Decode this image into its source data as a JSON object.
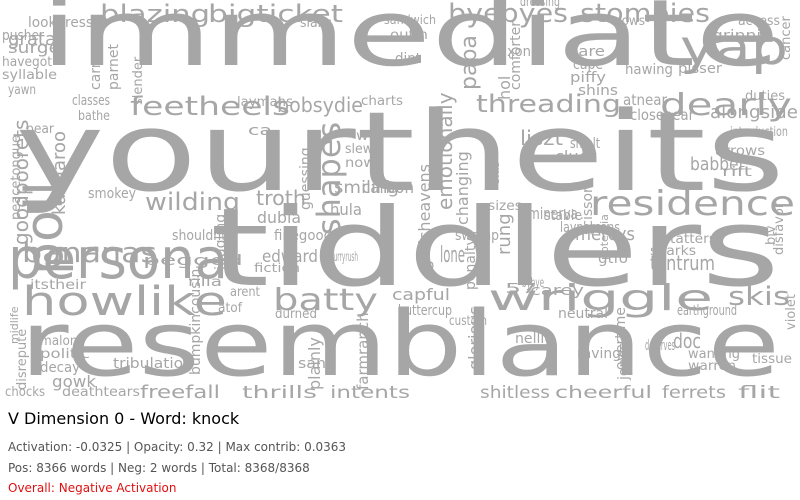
{
  "title": "V Dimension 0 - Word: knock",
  "stats_line": "Activation: -0.0325 | Opacity: 0.32 | Max contrib: 0.0363",
  "counts_line": "Pos: 8366 words | Neg: 2 words | Total: 8368/8368",
  "overall": "Overall: Negative Activation",
  "colors": {
    "word": "#a6a6a6",
    "title": "#000000",
    "meta": "#555555",
    "overall": "#e01010"
  },
  "word_cloud": [
    "immediate",
    "yourtheits",
    "tiddlers",
    "resemblance",
    "persona",
    "howlike",
    "poll",
    "bananas",
    "feetheels",
    "residence",
    "wriggle",
    "yap",
    "dearly",
    "byebyes",
    "stompies",
    "blazing",
    "bigticket",
    "threading",
    "batty",
    "bobsydie",
    "shapes",
    "skis",
    "wilding",
    "tantrum",
    "alongside",
    "mercys",
    "babber",
    "goodpoorets",
    "kangaroo",
    "grata",
    "lookdress",
    "pusher",
    "havegot",
    "syllable",
    "yawn",
    "surge",
    "classes",
    "bathe",
    "pear",
    "smokey",
    "peacetongue",
    "smiling",
    "hula",
    "carbon",
    "emotionally",
    "changing",
    "liszt",
    "cluck",
    "minerva",
    "smelt",
    "atnear",
    "closenear",
    "duties",
    "arrows",
    "flit",
    "ferrets",
    "cheerful",
    "shitless",
    "intents",
    "thrills",
    "freefall",
    "gowk",
    "decay",
    "politic",
    "malone",
    "disrepute",
    "midlife",
    "chocks",
    "deathtears",
    "tribulation",
    "nellie",
    "glorious",
    "jones",
    "raving",
    "wanting",
    "warren",
    "tissue",
    "capful",
    "buttercup",
    "custom",
    "neutral",
    "carey",
    "earthground",
    "troth",
    "dubia",
    "edward",
    "fiction",
    "finegood",
    "shouldnt",
    "itstheir",
    "rilla",
    "atof",
    "arent",
    "durned",
    "plainly",
    "farmranch",
    "scissors",
    "sharks",
    "tatters",
    "sizes",
    "rung",
    "stable",
    "laypersons",
    "penalty",
    "potentia",
    "gtfo",
    "swamp",
    "godsheavens",
    "juggling",
    "guessing",
    "slew",
    "nowt",
    "wily",
    "charts",
    "laymans",
    "nixon",
    "isare",
    "cape",
    "piffy",
    "shins",
    "hawing",
    "pisser",
    "grinnin",
    "access",
    "cows",
    "papa",
    "dint",
    "outin",
    "sandwich",
    "slans",
    "slender",
    "carney",
    "parnet",
    "dressing",
    "cancer",
    "pegged",
    "bumpkincousin",
    "hurryrush",
    "lone",
    "57",
    "bybye",
    "san",
    "doc",
    "ca",
    "skis",
    "hol",
    "comforter",
    "overtime",
    "deserves",
    "violet",
    "disfavor",
    "biv",
    "rift",
    "introduction",
    "ablebodied",
    "shag",
    "dite",
    "reading"
  ]
}
